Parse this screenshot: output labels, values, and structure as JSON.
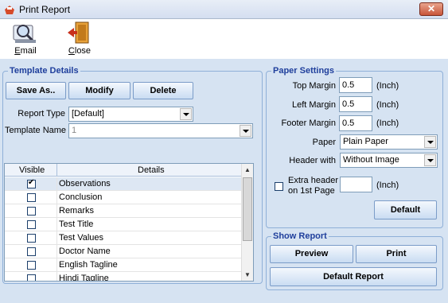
{
  "window": {
    "title": "Print Report",
    "close_glyph": "✕"
  },
  "toolbar": {
    "email_label_first": "E",
    "email_label_rest": "mail",
    "close_label_first": "C",
    "close_label_rest": "lose"
  },
  "template": {
    "group_title": "Template Details",
    "save_as": "Save As..",
    "modify": "Modify",
    "delete": "Delete",
    "report_type_label": "Report Type",
    "report_type_value": "[Default]",
    "template_name_label": "Template Name",
    "template_name_value": "1"
  },
  "grid": {
    "col_visible": "Visible",
    "col_details": "Details",
    "rows": [
      {
        "label": "Observations",
        "checked": true
      },
      {
        "label": "Conclusion",
        "checked": false
      },
      {
        "label": "Remarks",
        "checked": false
      },
      {
        "label": "Test Title",
        "checked": false
      },
      {
        "label": "Test Values",
        "checked": false
      },
      {
        "label": "Doctor Name",
        "checked": false
      },
      {
        "label": "English Tagline",
        "checked": false
      },
      {
        "label": "Hindi Tagline",
        "checked": false
      }
    ]
  },
  "paper": {
    "group_title": "Paper Settings",
    "top_margin_label": "Top Margin",
    "top_margin_value": "0.5",
    "left_margin_label": "Left Margin",
    "left_margin_value": "0.5",
    "footer_margin_label": "Footer Margin",
    "footer_margin_value": "0.5",
    "unit": "(Inch)",
    "paper_label": "Paper",
    "paper_value": "Plain Paper",
    "header_label": "Header with",
    "header_value": "Without Image",
    "extra_header_line1": "Extra header",
    "extra_header_line2": "on 1st Page",
    "extra_header_value": "",
    "default_btn": "Default"
  },
  "show_report": {
    "group_title": "Show Report",
    "preview": "Preview",
    "print": "Print",
    "default_report": "Default Report"
  },
  "colors": {
    "group_title": "#1f3f9c",
    "background": "#d6e3f2",
    "close_button": "#c8553a"
  },
  "icons": [
    "printer-app-icon",
    "email-icon",
    "close-door-icon"
  ]
}
